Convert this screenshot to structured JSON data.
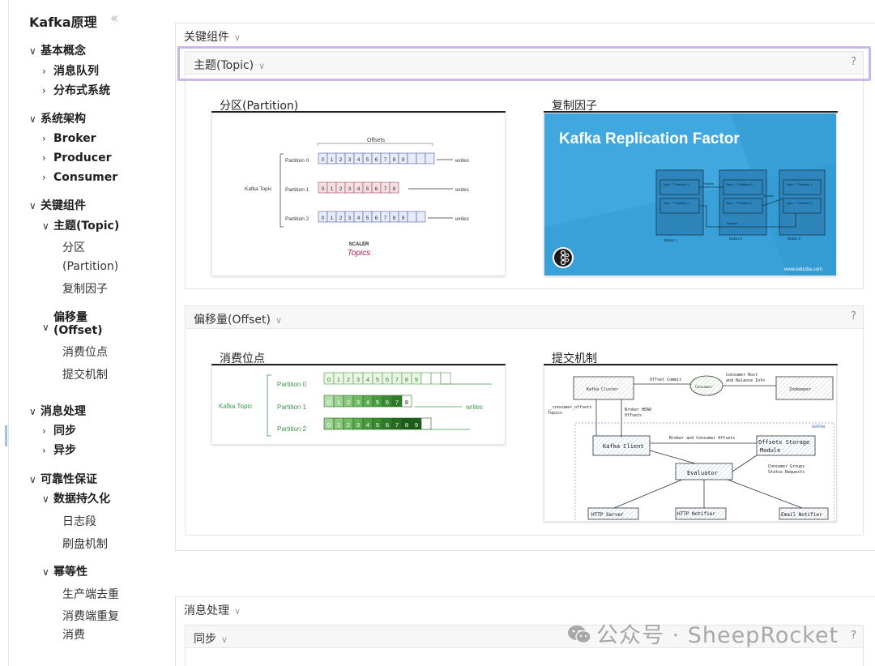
{
  "sidebar": {
    "title": "Kafka原理",
    "collapse_icon": "double-chevron-left-icon",
    "items": [
      {
        "label": "基本概念",
        "level": 0,
        "expanded": true
      },
      {
        "label": "消息队列",
        "level": 1,
        "expanded": false
      },
      {
        "label": "分布式系统",
        "level": 1,
        "expanded": false
      },
      {
        "label": "系统架构",
        "level": 0,
        "expanded": true
      },
      {
        "label": "Broker",
        "level": 1,
        "expanded": false
      },
      {
        "label": "Producer",
        "level": 1,
        "expanded": false
      },
      {
        "label": "Consumer",
        "level": 1,
        "expanded": false
      },
      {
        "label": "关键组件",
        "level": 0,
        "expanded": true
      },
      {
        "label": "主题(Topic)",
        "level": 1,
        "expanded": true
      },
      {
        "label": "分区",
        "level": 2
      },
      {
        "label": "(Partition)",
        "level": 2
      },
      {
        "label": "复制因子",
        "level": 2
      },
      {
        "label": "偏移量",
        "level": 1,
        "expanded": true
      },
      {
        "label": "(Offset)",
        "level": 1
      },
      {
        "label": "消费位点",
        "level": 2
      },
      {
        "label": "提交机制",
        "level": 2
      },
      {
        "label": "消息处理",
        "level": 0,
        "expanded": true
      },
      {
        "label": "同步",
        "level": 1,
        "expanded": false
      },
      {
        "label": "异步",
        "level": 1,
        "expanded": false
      },
      {
        "label": "可靠性保证",
        "level": 0,
        "expanded": true
      },
      {
        "label": "数据持久化",
        "level": 1,
        "expanded": true
      },
      {
        "label": "日志段",
        "level": 2
      },
      {
        "label": "刷盘机制",
        "level": 2
      },
      {
        "label": "幂等性",
        "level": 1,
        "expanded": true
      },
      {
        "label": "生产端去重",
        "level": 2
      },
      {
        "label": "消费端重复",
        "level": 2
      },
      {
        "label": "消费",
        "level": 2
      }
    ]
  },
  "main": {
    "section_key": {
      "label": "关键组件"
    },
    "panel_topic": {
      "label": "主题(Topic)",
      "help": "?",
      "cards": [
        {
          "title": "分区(Partition)"
        },
        {
          "title": "复制因子"
        }
      ]
    },
    "panel_offset": {
      "label": "偏移量(Offset)",
      "help": "?",
      "cards": [
        {
          "title": "消费位点"
        },
        {
          "title": "提交机制"
        }
      ]
    },
    "section_msg": {
      "label": "消息处理"
    },
    "panel_sync": {
      "label": "同步",
      "help": "?"
    }
  },
  "img_partition": {
    "offsets": "Offsets",
    "topic": "Kafka Topic",
    "partitions": [
      "Partition 0",
      "Partition 1",
      "Partition 2"
    ],
    "writes": "writes",
    "logo_top": "SCALER",
    "logo_bottom": "Topics"
  },
  "img_replication": {
    "title": "Kafka Replication Factor",
    "site": "www.educba.com",
    "brokers": [
      "Broker 1",
      "Broker 2",
      "Broker 3"
    ],
    "boxes": [
      [
        "Topic - T Partition 0",
        "Topic - T Partition 2"
      ],
      [
        "Topic - T Partition 0",
        "Topic - T Partition 1"
      ],
      [
        "Topic - T Partition 1",
        "Topic - T Partition 2"
      ]
    ],
    "replica": "Replica"
  },
  "img_consumer": {
    "topic": "Kafka Topic",
    "partitions": [
      "Partition 0",
      "Partition 1",
      "Partition 2"
    ],
    "writes": "writes"
  },
  "img_commit": {
    "kafka_cluster": "Kafka Cluster",
    "consumer": "Consumer",
    "zookeeper": "Zookeeper",
    "offset_commit": "Offset Commit",
    "consumer_host": "Consumer Host",
    "balance_info": "and Balance Info",
    "consumer_offsets": "__consumer_offsets",
    "topics": "Topics",
    "broker_head": "Broker HEAD",
    "offsets": "Offsets",
    "burrow": "BURROW",
    "kafka_client": "Kafka Client",
    "broker_consumer_offsets": "Broker and Consumer Offsets",
    "storage": "Offsets Storage",
    "module": "Module",
    "evaluator": "Evaluator",
    "groups": "Consumer Groups",
    "status": "Status Requests",
    "http_server": "HTTP Server",
    "http_notifier": "HTTP Notifier",
    "email_notifier": "Email Notifier"
  },
  "watermark": {
    "text": "公众号 · SheepRocket",
    "icon": "wechat-icon"
  }
}
